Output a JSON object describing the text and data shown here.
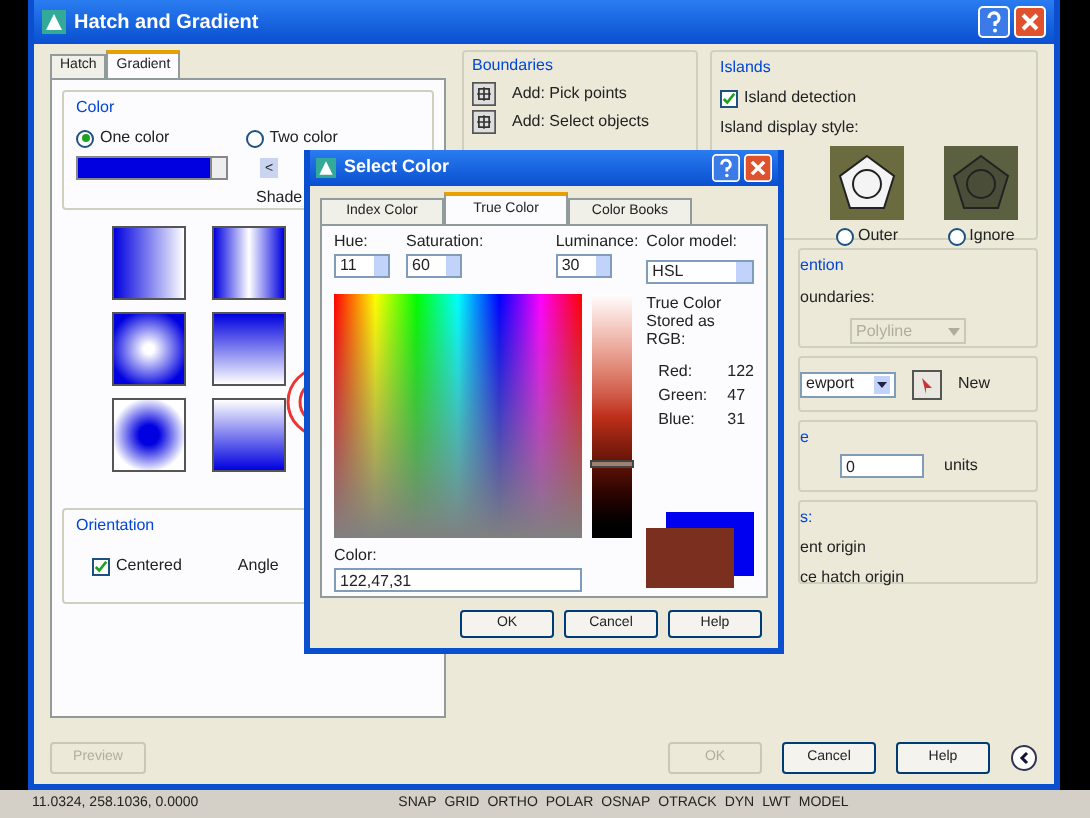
{
  "window": {
    "title": "Hatch and Gradient"
  },
  "tabs": [
    {
      "label": "Hatch",
      "selected": false
    },
    {
      "label": "Gradient",
      "selected": true
    }
  ],
  "color_group": {
    "title": "Color",
    "options": [
      {
        "label": "One color",
        "selected": true
      },
      {
        "label": "Two color",
        "selected": false
      }
    ],
    "shade_button": "<",
    "shade_label": "Shade"
  },
  "orientation": {
    "title": "Orientation",
    "centered": {
      "label": "Centered",
      "checked": true
    },
    "angle_label": "Angle"
  },
  "preview_button": {
    "label": "Preview",
    "disabled": true
  },
  "boundaries": {
    "title": "Boundaries",
    "buttons": [
      "Add: Pick points",
      "Add: Select objects"
    ]
  },
  "islands": {
    "title": "Islands",
    "detection": {
      "label": "Island detection",
      "checked": true
    },
    "style_label": "Island display style:",
    "styles": [
      {
        "label": "Outer",
        "selected": false
      },
      {
        "label": "Ignore",
        "selected": false
      }
    ]
  },
  "retention": {
    "title": "ention",
    "label": "oundaries:",
    "dropdown": "Polyline"
  },
  "boundary_set": {
    "dropdown": "ewport",
    "new_button": "New"
  },
  "gap": {
    "title": "e",
    "value": "0",
    "unit": "units"
  },
  "inherit": {
    "title": "s:",
    "lines": [
      "ent origin",
      "ce hatch origin"
    ]
  },
  "footer_buttons": [
    {
      "label": "OK",
      "disabled": true
    },
    {
      "label": "Cancel",
      "disabled": false
    },
    {
      "label": "Help",
      "disabled": false
    }
  ],
  "status_bar": {
    "coordinates": "11.0324, 258.1036, 0.0000",
    "toggles": [
      "SNAP",
      "GRID",
      "ORTHO",
      "POLAR",
      "OSNAP",
      "OTRACK",
      "DYN",
      "LWT",
      "MODEL"
    ]
  },
  "select_color": {
    "title": "Select Color",
    "tabs": [
      {
        "label": "Index Color",
        "selected": false
      },
      {
        "label": "True Color",
        "selected": true
      },
      {
        "label": "Color Books",
        "selected": false
      }
    ],
    "hue": {
      "label": "Hue:",
      "value": "11"
    },
    "saturation": {
      "label": "Saturation:",
      "value": "60"
    },
    "luminance": {
      "label": "Luminance:",
      "value": "30",
      "level": 0.3
    },
    "color_model": {
      "label": "Color model:",
      "value": "HSL"
    },
    "stored_label": "True Color Stored as RGB:",
    "rgb": [
      {
        "label": "Red:",
        "value": "122"
      },
      {
        "label": "Green:",
        "value": "47"
      },
      {
        "label": "Blue:",
        "value": "31"
      }
    ],
    "color_label": "Color:",
    "color_value": "122,47,31",
    "buttons": [
      "OK",
      "Cancel",
      "Help"
    ]
  }
}
